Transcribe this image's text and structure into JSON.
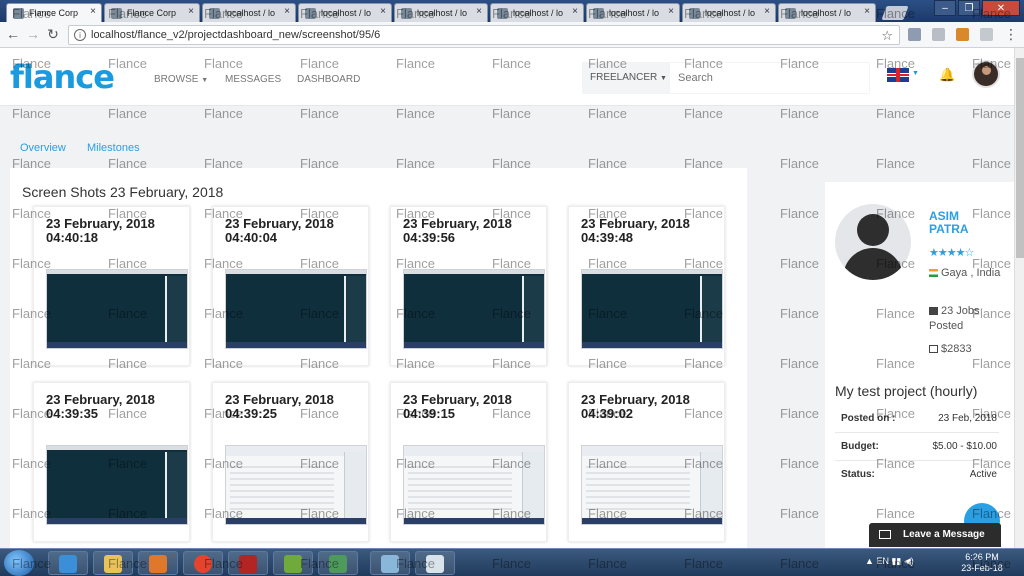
{
  "browser": {
    "tabs": [
      "Flance Corp",
      "Flance Corp",
      "localhost / lo",
      "localhost / lo",
      "localhost / lo",
      "localhost / lo",
      "localhost / lo",
      "localhost / lo",
      "localhost / lo"
    ],
    "url": "localhost/flance_v2/projectdashboard_new/screenshot/95/6"
  },
  "header": {
    "logo": "flance",
    "nav": [
      "BROWSE",
      "MESSAGES",
      "DASHBOARD"
    ],
    "freelancer_label": "FREELANCER",
    "search_placeholder": "Search"
  },
  "subnav": [
    "Overview",
    "Milestones"
  ],
  "main": {
    "title": "Screen Shots 23 February, 2018",
    "shots": [
      {
        "date": "23 February, 2018",
        "time": "04:40:18",
        "kind": "dark"
      },
      {
        "date": "23 February, 2018",
        "time": "04:40:04",
        "kind": "dark"
      },
      {
        "date": "23 February, 2018",
        "time": "04:39:56",
        "kind": "dark"
      },
      {
        "date": "23 February, 2018",
        "time": "04:39:48",
        "kind": "dark"
      },
      {
        "date": "23 February, 2018",
        "time": "04:39:35",
        "kind": "dark"
      },
      {
        "date": "23 February, 2018",
        "time": "04:39:25",
        "kind": "web"
      },
      {
        "date": "23 February, 2018",
        "time": "04:39:15",
        "kind": "web"
      },
      {
        "date": "23 February, 2018",
        "time": "04:39:02",
        "kind": "web"
      }
    ]
  },
  "client": {
    "name": "ASIM PATRA",
    "stars": "★★★★☆",
    "location": "Gaya , India",
    "jobs": "23 Jobs Posted",
    "spent": "$2833"
  },
  "project": {
    "title": "My test project (hourly)",
    "rows": [
      {
        "label": "Posted on :",
        "value": "23 Feb, 2018"
      },
      {
        "label": "Budget:",
        "value": "$5.00 - $10.00"
      },
      {
        "label": "Status:",
        "value": "Active"
      }
    ]
  },
  "chat": {
    "label": "Leave a Message"
  },
  "taskbar": {
    "time": "6:26 PM",
    "date": "23-Feb-18",
    "lang": "EN"
  },
  "watermark": "Flance"
}
